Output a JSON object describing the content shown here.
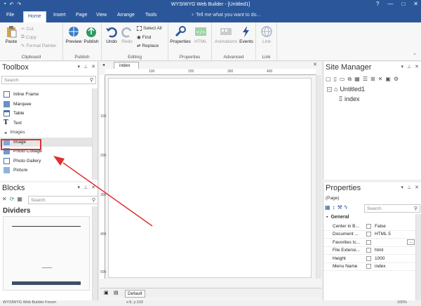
{
  "window": {
    "title": "WYSIWYG Web Builder - [Untitled1]",
    "buttons": [
      "?",
      "—",
      "□",
      "✕"
    ]
  },
  "menu": {
    "tabs": [
      "File",
      "Home",
      "Insert",
      "Page",
      "View",
      "Arrange",
      "Tools"
    ],
    "tell": "Tell me what you want to do..."
  },
  "ribbon": {
    "clipboard": {
      "label": "Clipboard",
      "paste": "Paste",
      "cut": "Cut",
      "copy": "Copy",
      "format": "Format Painter"
    },
    "publish": {
      "label": "Publish",
      "preview": "Preview",
      "publish": "Publish"
    },
    "editing": {
      "label": "Editing",
      "undo": "Undo",
      "redo": "Redo",
      "selectall": "Select All",
      "find": "Find",
      "replace": "Replace"
    },
    "properties": {
      "label": "Properties",
      "properties": "Properties",
      "html": "HTML"
    },
    "advanced": {
      "label": "Advanced",
      "animations": "Animations",
      "events": "Events"
    },
    "link": {
      "label": "Link",
      "link": "Link"
    }
  },
  "toolbox": {
    "title": "Toolbox",
    "search": "Search",
    "items": [
      "Inline Frame",
      "Marquee",
      "Table",
      "Text"
    ],
    "section": "Images",
    "image_items": [
      "Image",
      "Photo Collage",
      "Photo Gallery",
      "Picture"
    ]
  },
  "blocks": {
    "title": "Blocks",
    "search": "Search",
    "section": "Dividers"
  },
  "editor": {
    "tab": "index",
    "ruler_h": [
      "100",
      "200",
      "300",
      "400"
    ],
    "ruler_v": [
      "100",
      "200",
      "300",
      "400",
      "500"
    ],
    "bottom_tab": "Default"
  },
  "sitemanager": {
    "title": "Site Manager",
    "root": "Untitled1",
    "page": "index"
  },
  "properties": {
    "title": "Properties",
    "selector": "(Page)",
    "search": "Search",
    "section": "General",
    "rows": [
      {
        "k": "Center in B...",
        "v": "False"
      },
      {
        "k": "Document ...",
        "v": "HTML 5"
      },
      {
        "k": "Favorites Ic...",
        "v": ""
      },
      {
        "k": "File Extensi...",
        "v": "html"
      },
      {
        "k": "Height",
        "v": "1000"
      },
      {
        "k": "Menu Name",
        "v": "index"
      }
    ]
  },
  "status": {
    "left": "WYSIWYG Web Builder Forum",
    "coords": "x:9, y:103",
    "zoom": "100%"
  },
  "colors": {
    "accent": "#2b579a",
    "arrow": "#e0302f"
  }
}
